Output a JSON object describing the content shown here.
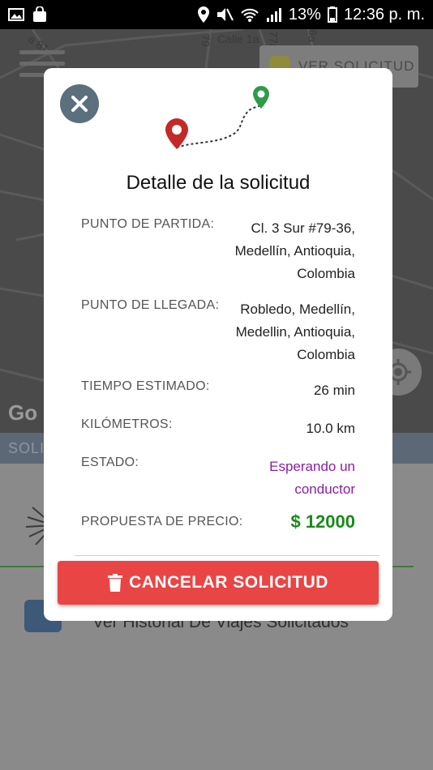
{
  "status_bar": {
    "battery": "13%",
    "time": "12:36 p. m."
  },
  "map": {
    "street_labels": [
      "a 81",
      "Calle 1a",
      "79",
      "77a",
      "6a"
    ],
    "ver_solicitud_label": "VER SOLICITUD",
    "google_logo": "Go"
  },
  "app": {
    "sol_bar_label": "SOLI",
    "history_label": "Ver Historial De Viajes Solicitados"
  },
  "modal": {
    "title": "Detalle de la solicitud",
    "rows": [
      {
        "label": "PUNTO DE PARTIDA:",
        "value": "Cl. 3 Sur #79-36,\nMedellín, Antioquia,\nColombia"
      },
      {
        "label": "PUNTO DE LLEGADA:",
        "value": "Robledo, Medellín,\nMedellin, Antioquia,\nColombia"
      },
      {
        "label": "TIEMPO ESTIMADO:",
        "value": "26 min"
      },
      {
        "label": "KILÓMETROS:",
        "value": "10.0 km"
      },
      {
        "label": "ESTADO:",
        "value": "Esperando un\nconductor"
      },
      {
        "label": "PROPUESTA DE PRECIO:",
        "value": "$ 12000"
      }
    ],
    "cancel_label": "CANCELAR SOLICITUD"
  },
  "colors": {
    "cancel_red": "#e94545",
    "price_green": "#1a8a1a",
    "status_purple": "#8a1fa0",
    "close_btn": "#5b6f7d",
    "pin_red": "#c62828",
    "pin_green": "#2e9b4a"
  },
  "icons": {
    "close": "close-icon",
    "route": "route-pins-icon",
    "trash": "trash-icon",
    "hamburger": "hamburger-icon",
    "locate": "locate-icon"
  }
}
